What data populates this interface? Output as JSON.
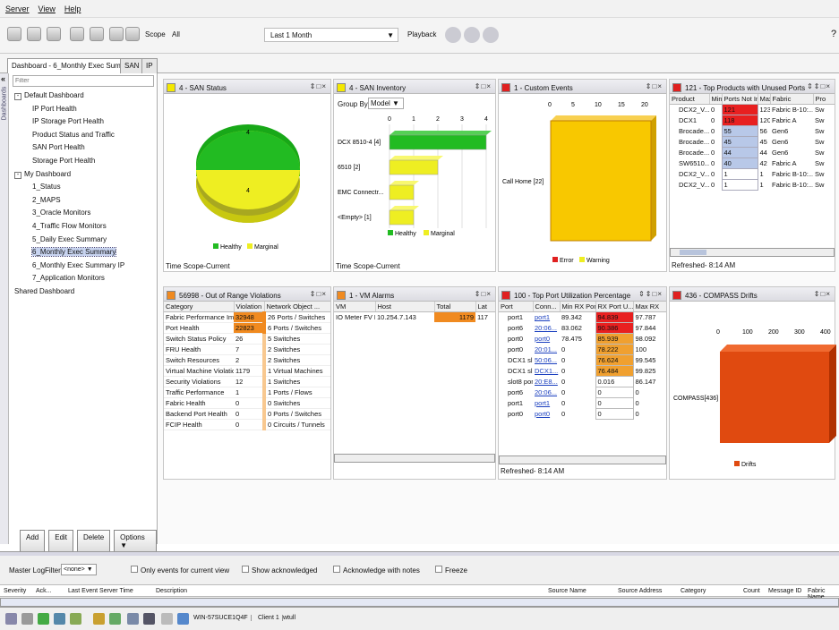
{
  "menu": [
    "Server",
    "View",
    "Help"
  ],
  "toolbar": {
    "scope_label": "Scope",
    "scope_value": "All",
    "time_range": "Last 1 Month",
    "playback_label": "Playback"
  },
  "tabs": [
    {
      "label": "Dashboard - 6_Monthly Exec Summary"
    },
    {
      "label": "SAN"
    },
    {
      "label": "IP"
    }
  ],
  "sidebar": {
    "vertical_label": "Dashboards",
    "filter_placeholder": "Filter",
    "tree": [
      {
        "label": "Default Dashboard",
        "level": 0,
        "expand": "-"
      },
      {
        "label": "IP Port Health",
        "level": 1
      },
      {
        "label": "IP Storage Port Health",
        "level": 1
      },
      {
        "label": "Product Status and Traffic",
        "level": 1
      },
      {
        "label": "SAN Port Health",
        "level": 1
      },
      {
        "label": "Storage Port Health",
        "level": 1
      },
      {
        "label": "My Dashboard",
        "level": 0,
        "expand": "-"
      },
      {
        "label": "1_Status",
        "level": 1
      },
      {
        "label": "2_MAPS",
        "level": 1
      },
      {
        "label": "3_Oracle Monitors",
        "level": 1
      },
      {
        "label": "4_Traffic Flow Monitors",
        "level": 1
      },
      {
        "label": "5_Daily Exec Summary",
        "level": 1
      },
      {
        "label": "6_Monthly Exec Summary",
        "level": 1,
        "selected": true
      },
      {
        "label": "6_Monthly Exec Summary IP",
        "level": 1
      },
      {
        "label": "7_Application Monitors",
        "level": 1
      },
      {
        "label": "Shared Dashboard",
        "level": 0
      }
    ],
    "buttons": {
      "add": "Add",
      "edit": "Edit",
      "delete": "Delete",
      "options": "Options"
    }
  },
  "panels": {
    "san_status": {
      "title": "4 - SAN Status",
      "healthy_value": "4",
      "marginal_value": "4",
      "legend_healthy": "Healthy",
      "legend_marginal": "Marginal",
      "footer": "Time Scope-Current",
      "colors": {
        "healthy": "#22bb22",
        "marginal": "#eeee22"
      }
    },
    "san_inventory": {
      "title": "4 - SAN Inventory",
      "group_by_label": "Group By",
      "group_by_value": "Model",
      "footer": "Time Scope-Current",
      "legend_healthy": "Healthy",
      "legend_marginal": "Marginal"
    },
    "custom_events": {
      "title": "1 - Custom Events",
      "legend_error": "Error",
      "legend_warning": "Warning"
    },
    "top_products": {
      "title": "121 - Top Products with Unused Ports",
      "columns": [
        "Product",
        "Min",
        "Ports Not In ...",
        "Max",
        "Fabric",
        "Pro"
      ],
      "rows": [
        [
          "DCX2_V...",
          "0",
          "121",
          "123",
          "Fabric B-10:...",
          "Sw"
        ],
        [
          "DCX1",
          "0",
          "118",
          "120",
          "Fabric A",
          "Sw"
        ],
        [
          "Brocade...",
          "0",
          "55",
          "56",
          "Gen6",
          "Sw"
        ],
        [
          "Brocade...",
          "0",
          "45",
          "45",
          "Gen6",
          "Sw"
        ],
        [
          "Brocade...",
          "0",
          "44",
          "44",
          "Gen6",
          "Sw"
        ],
        [
          "SW6510...",
          "0",
          "40",
          "42",
          "Fabric A",
          "Sw"
        ],
        [
          "DCX2_V...",
          "0",
          "1",
          "1",
          "Fabric B-10:...",
          "Sw"
        ],
        [
          "DCX2_V...",
          "0",
          "1",
          "1",
          "Fabric B-10:...",
          "Sw"
        ]
      ],
      "footer": "Refreshed- 8:14 AM"
    },
    "violations": {
      "title": "56998 - Out of Range Violations",
      "columns": [
        "Category",
        "Violation ...",
        "Network Object ..."
      ],
      "rows": [
        [
          "Fabric Performance Impact",
          "32948",
          "26 Ports / Switches"
        ],
        [
          "Port Health",
          "22823",
          "6 Ports / Switches"
        ],
        [
          "Switch Status Policy",
          "26",
          "5 Switches"
        ],
        [
          "FRU Health",
          "7",
          "2 Switches"
        ],
        [
          "Switch Resources",
          "2",
          "2 Switches"
        ],
        [
          "Virtual Machine Violations",
          "1179",
          "1 Virtual Machines"
        ],
        [
          "Security Violations",
          "12",
          "1 Switches"
        ],
        [
          "Traffic Performance",
          "1",
          "1 Ports / Flows"
        ],
        [
          "Fabric Health",
          "0",
          "0 Switches"
        ],
        [
          "Backend Port Health",
          "0",
          "0 Ports / Switches"
        ],
        [
          "FCIP Health",
          "0",
          "0 Circuits / Tunnels"
        ]
      ]
    },
    "vm_alarms": {
      "title": "1 - VM Alarms",
      "columns": [
        "VM",
        "Host",
        "Total",
        "Lat"
      ],
      "rows": [
        [
          "IO Meter FV D...",
          "10.254.7.143",
          "1179",
          "117"
        ]
      ]
    },
    "port_util": {
      "title": "100 - Top Port Utilization Percentage",
      "columns": [
        "Port",
        "Conn...",
        "Min RX Port ...",
        "RX Port U...",
        "Max RX"
      ],
      "rows": [
        [
          "port1",
          "port1",
          "89.342",
          "94.839",
          "97.787"
        ],
        [
          "port6",
          "20:06...",
          "83.062",
          "90.386",
          "97.844"
        ],
        [
          "port0",
          "port0",
          "78.475",
          "85.939",
          "98.092"
        ],
        [
          "port0",
          "20:01...",
          "0",
          "78.222",
          "100"
        ],
        [
          "DCX1 sl...",
          "50:06...",
          "0",
          "76.624",
          "99.545"
        ],
        [
          "DCX1 sl...",
          "DCX1...",
          "0",
          "76.484",
          "99.825"
        ],
        [
          "slot8 por...",
          "20:E8...",
          "0",
          "0.016",
          "86.147"
        ],
        [
          "port6",
          "20:06...",
          "0",
          "0",
          "0"
        ],
        [
          "port1",
          "port1",
          "0",
          "0",
          "0"
        ],
        [
          "port0",
          "port0",
          "0",
          "0",
          "0"
        ]
      ],
      "footer": "Refreshed- 8:14 AM"
    },
    "compass": {
      "title": "436 - COMPASS Drifts",
      "legend": "Drifts"
    }
  },
  "chart_data": [
    {
      "type": "pie",
      "title": "4 - SAN Status",
      "labels": [
        "Healthy",
        "Marginal"
      ],
      "values": [
        4,
        4
      ]
    },
    {
      "type": "bar",
      "title": "4 - SAN Inventory",
      "categories": [
        "DCX 8510-4 [4]",
        "6510 [2]",
        "EMC Connectr...",
        "<Empty> [1]"
      ],
      "series": [
        {
          "name": "Healthy",
          "values": [
            4,
            0,
            0,
            0
          ]
        },
        {
          "name": "Marginal",
          "values": [
            0,
            2,
            1,
            1
          ]
        }
      ],
      "xlim": [
        0,
        4
      ],
      "xticks": [
        0,
        1,
        2,
        3,
        4
      ]
    },
    {
      "type": "bar",
      "title": "1 - Custom Events",
      "categories": [
        "Call Home [22]"
      ],
      "series": [
        {
          "name": "Error",
          "values": [
            0
          ]
        },
        {
          "name": "Warning",
          "values": [
            22
          ]
        }
      ],
      "xlim": [
        0,
        20
      ],
      "xticks": [
        0,
        5,
        10,
        15,
        20
      ]
    },
    {
      "type": "bar",
      "title": "436 - COMPASS Drifts",
      "categories": [
        "COMPASS[436]"
      ],
      "series": [
        {
          "name": "Drifts",
          "values": [
            436
          ]
        }
      ],
      "xlim": [
        0,
        400
      ],
      "xticks": [
        0,
        100,
        200,
        300,
        400
      ]
    }
  ],
  "master_log": {
    "title": "Master Log",
    "filter_label": "Filter",
    "filter_value": "<none>",
    "cb_current": "Only events for current view",
    "cb_ack": "Show acknowledged",
    "cb_notes": "Acknowledge with notes",
    "cb_freeze": "Freeze",
    "columns": [
      "Severity",
      "Ack...",
      "Last Event Server Time",
      "Description",
      "Source Name",
      "Source Address",
      "Category",
      "Count",
      "Message ID",
      "Fabric Name"
    ]
  },
  "statusbar": {
    "host": "WIN-57SUCE1Q4F",
    "client": "Client 1",
    "user": "wtull"
  }
}
